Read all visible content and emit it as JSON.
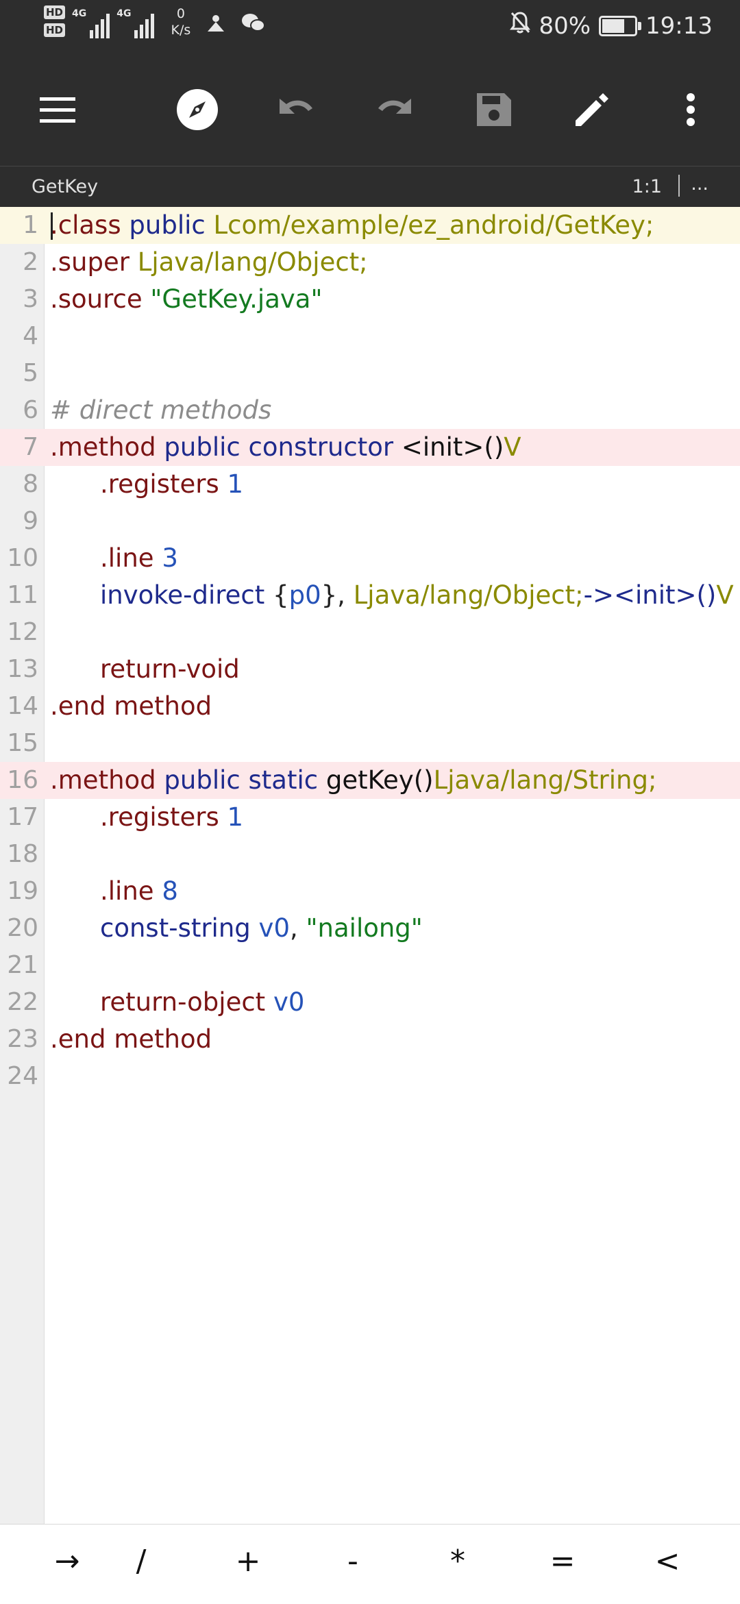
{
  "status_bar": {
    "hd_badge_1": "HD",
    "hd_badge_2": "HD",
    "network_1": "4G",
    "network_2": "4G",
    "speed_value": "0",
    "speed_unit": "K/s",
    "battery_percent": "80%",
    "battery_level": 0.8,
    "time": "19:13",
    "icons": [
      "signal-icon",
      "signal-icon",
      "vpn-icon",
      "wechat-icon",
      "mute-bell-icon",
      "battery-icon"
    ]
  },
  "toolbar": {
    "icons": [
      "menu-icon",
      "compass-icon",
      "undo-icon",
      "redo-icon",
      "save-icon",
      "edit-icon",
      "more-vert-icon"
    ]
  },
  "file_tab": {
    "title": "GetKey",
    "cursor_position": "1:1",
    "more": "..."
  },
  "editor": {
    "lines": [
      {
        "n": "1",
        "tokens": [
          {
            "t": ".class",
            "c": "dir"
          },
          {
            "t": " "
          },
          {
            "t": "public",
            "c": "kw"
          },
          {
            "t": " "
          },
          {
            "t": "Lcom/example/ez_android/GetKey;",
            "c": "type"
          }
        ]
      },
      {
        "n": "2",
        "tokens": [
          {
            "t": ".super",
            "c": "dir"
          },
          {
            "t": " "
          },
          {
            "t": "Ljava/lang/Object;",
            "c": "type"
          }
        ]
      },
      {
        "n": "3",
        "tokens": [
          {
            "t": ".source",
            "c": "dir"
          },
          {
            "t": " "
          },
          {
            "t": "\"GetKey.java\"",
            "c": "str"
          }
        ]
      },
      {
        "n": "4",
        "tokens": []
      },
      {
        "n": "5",
        "tokens": []
      },
      {
        "n": "6",
        "tokens": [
          {
            "t": "# direct methods",
            "c": "cmt"
          }
        ]
      },
      {
        "n": "7",
        "tokens": [
          {
            "t": ".method",
            "c": "dir"
          },
          {
            "t": " "
          },
          {
            "t": "public",
            "c": "kw"
          },
          {
            "t": " "
          },
          {
            "t": "constructor",
            "c": "kw"
          },
          {
            "t": " "
          },
          {
            "t": "<init>()",
            "c": "id"
          },
          {
            "t": "V",
            "c": "type"
          }
        ]
      },
      {
        "n": "8",
        "indent": true,
        "tokens": [
          {
            "t": ".registers",
            "c": "dir"
          },
          {
            "t": " "
          },
          {
            "t": "1",
            "c": "num"
          }
        ]
      },
      {
        "n": "9",
        "tokens": []
      },
      {
        "n": "10",
        "indent": true,
        "tokens": [
          {
            "t": ".line",
            "c": "dir"
          },
          {
            "t": " "
          },
          {
            "t": "3",
            "c": "num"
          }
        ]
      },
      {
        "n": "11",
        "indent": true,
        "tokens": [
          {
            "t": "invoke-direct",
            "c": "kw"
          },
          {
            "t": " {",
            "c": "op"
          },
          {
            "t": "p0",
            "c": "reg"
          },
          {
            "t": "}, ",
            "c": "op"
          },
          {
            "t": "Ljava/lang/Object;",
            "c": "type"
          },
          {
            "t": "-><init>()",
            "c": "kw"
          },
          {
            "t": "V",
            "c": "type"
          }
        ]
      },
      {
        "n": "12",
        "tokens": []
      },
      {
        "n": "13",
        "indent": true,
        "tokens": [
          {
            "t": "return-void",
            "c": "dir"
          }
        ]
      },
      {
        "n": "14",
        "tokens": [
          {
            "t": ".end",
            "c": "dir"
          },
          {
            "t": " "
          },
          {
            "t": "method",
            "c": "dir"
          }
        ]
      },
      {
        "n": "15",
        "tokens": []
      },
      {
        "n": "16",
        "tokens": [
          {
            "t": ".method",
            "c": "dir"
          },
          {
            "t": " "
          },
          {
            "t": "public",
            "c": "kw"
          },
          {
            "t": " "
          },
          {
            "t": "static",
            "c": "kw"
          },
          {
            "t": " "
          },
          {
            "t": "getKey()",
            "c": "id"
          },
          {
            "t": "Ljava/lang/String;",
            "c": "type"
          }
        ]
      },
      {
        "n": "17",
        "indent": true,
        "tokens": [
          {
            "t": ".registers",
            "c": "dir"
          },
          {
            "t": " "
          },
          {
            "t": "1",
            "c": "num"
          }
        ]
      },
      {
        "n": "18",
        "tokens": []
      },
      {
        "n": "19",
        "indent": true,
        "tokens": [
          {
            "t": ".line",
            "c": "dir"
          },
          {
            "t": " "
          },
          {
            "t": "8",
            "c": "num"
          }
        ]
      },
      {
        "n": "20",
        "indent": true,
        "tokens": [
          {
            "t": "const-string",
            "c": "kw"
          },
          {
            "t": " "
          },
          {
            "t": "v0",
            "c": "reg"
          },
          {
            "t": ", ",
            "c": "op"
          },
          {
            "t": "\"nailong\"",
            "c": "str"
          }
        ]
      },
      {
        "n": "21",
        "tokens": []
      },
      {
        "n": "22",
        "indent": true,
        "tokens": [
          {
            "t": "return-object",
            "c": "dir"
          },
          {
            "t": " "
          },
          {
            "t": "v0",
            "c": "reg"
          }
        ]
      },
      {
        "n": "23",
        "tokens": [
          {
            "t": ".end",
            "c": "dir"
          },
          {
            "t": " "
          },
          {
            "t": "method",
            "c": "dir"
          }
        ]
      },
      {
        "n": "24",
        "tokens": []
      }
    ]
  },
  "key_bar": {
    "keys": [
      "→",
      "/",
      "+",
      "-",
      "*",
      "=",
      "<"
    ]
  },
  "colors": {
    "bar_background": "#2d2d2d",
    "current_line": "#fcf8e3",
    "method_line": "#fde8ea",
    "directive": "#7a1414",
    "keyword": "#1e2a8c",
    "type": "#8a8a00",
    "string": "#137a20",
    "number": "#2552b8",
    "comment": "#8c8c8c"
  }
}
